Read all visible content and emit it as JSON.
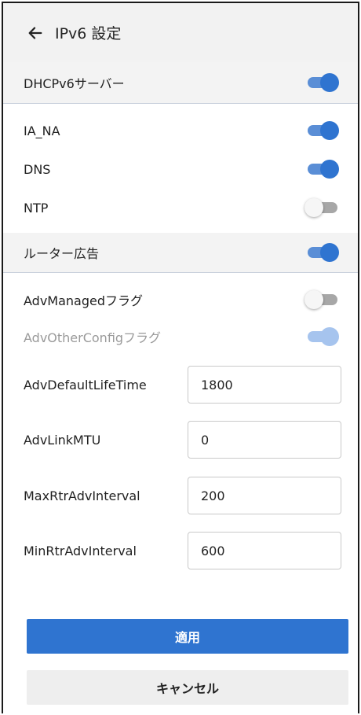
{
  "header": {
    "title": "IPv6 設定"
  },
  "dhcp": {
    "label": "DHCPv6サーバー",
    "enabled": true,
    "items": [
      {
        "label": "IA_NA",
        "enabled": true
      },
      {
        "label": "DNS",
        "enabled": true
      },
      {
        "label": "NTP",
        "enabled": false
      }
    ]
  },
  "ra": {
    "label": "ルーター広告",
    "enabled": true,
    "managed_flag": {
      "label": "AdvManagedフラグ",
      "enabled": false
    },
    "other_flag": {
      "label": "AdvOtherConfigフラグ",
      "enabled": true,
      "disabled": true
    },
    "fields": [
      {
        "label": "AdvDefaultLifeTime",
        "value": "1800"
      },
      {
        "label": "AdvLinkMTU",
        "value": "0"
      },
      {
        "label": "MaxRtrAdvInterval",
        "value": "200"
      },
      {
        "label": "MinRtrAdvInterval",
        "value": "600"
      }
    ]
  },
  "actions": {
    "apply": "適用",
    "cancel": "キャンセル"
  },
  "colors": {
    "accent": "#2f74d0",
    "accent_track": "#5a8ed6",
    "section_bg": "#f3f3f3"
  },
  "icons": {
    "back": "arrow-left-icon"
  }
}
